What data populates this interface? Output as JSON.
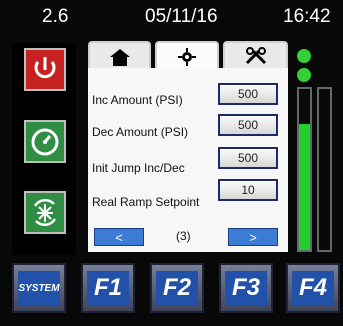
{
  "status": {
    "left_value": "2.6",
    "date": "05/11/16",
    "time": "16:42"
  },
  "tabs": {
    "home_icon": "home-icon",
    "settings_icon": "gear-icon",
    "tools_icon": "tools-icon"
  },
  "settings": {
    "rows": [
      {
        "label": "Inc Amount (PSI)",
        "value": "500"
      },
      {
        "label": "Dec Amount (PSI)",
        "value": "500"
      },
      {
        "label": "Init Jump Inc/Dec",
        "value": "500"
      },
      {
        "label": "Real Ramp Setpoint",
        "value": "10"
      }
    ],
    "nav_prev": "<",
    "nav_next": ">",
    "page": "(3)"
  },
  "function_keys": [
    {
      "label": "SYSTEM"
    },
    {
      "label": "F1"
    },
    {
      "label": "F2"
    },
    {
      "label": "F3"
    },
    {
      "label": "F4"
    }
  ],
  "indicator": {
    "bars": [
      {
        "level": 0.78
      },
      {
        "level": 0.0
      }
    ]
  },
  "colors": {
    "power_button": "#c62221",
    "meter_button": "#2f8e44",
    "snow_button": "#2f8e44",
    "indicator_green": "#31d137",
    "bar_fill": "#22cf2c",
    "nav_blue": "#3c7bd6",
    "fkey_blue": "#2151a9"
  },
  "side_icons": [
    "power-icon",
    "gauge-icon",
    "snowflake-cycle-icon"
  ]
}
